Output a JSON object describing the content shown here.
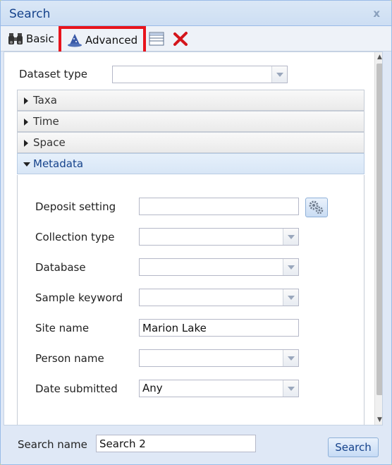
{
  "window": {
    "title": "Search",
    "close_glyph": "x"
  },
  "toolbar": {
    "basic_label": "Basic",
    "advanced_label": "Advanced",
    "highlight_color": "#e8141c"
  },
  "dataset_type": {
    "label": "Dataset type",
    "value": ""
  },
  "panels": [
    {
      "title": "Taxa",
      "expanded": false
    },
    {
      "title": "Time",
      "expanded": false
    },
    {
      "title": "Space",
      "expanded": false
    },
    {
      "title": "Metadata",
      "expanded": true
    }
  ],
  "metadata": {
    "deposit_setting": {
      "label": "Deposit setting",
      "value": ""
    },
    "collection_type": {
      "label": "Collection type",
      "value": ""
    },
    "database": {
      "label": "Database",
      "value": ""
    },
    "sample_keyword": {
      "label": "Sample keyword",
      "value": ""
    },
    "site_name": {
      "label": "Site name",
      "value": "Marion Lake"
    },
    "person_name": {
      "label": "Person name",
      "value": ""
    },
    "date_submitted": {
      "label": "Date submitted",
      "value": "Any"
    }
  },
  "footer": {
    "search_name_label": "Search name",
    "search_name_value": "Search 2",
    "search_button": "Search"
  },
  "icons": {
    "basic": "binoculars-icon",
    "advanced": "wizard-hat-icon",
    "layers": "layers-icon",
    "clear": "red-x-icon",
    "deposit_lookup": "gears-icon"
  }
}
